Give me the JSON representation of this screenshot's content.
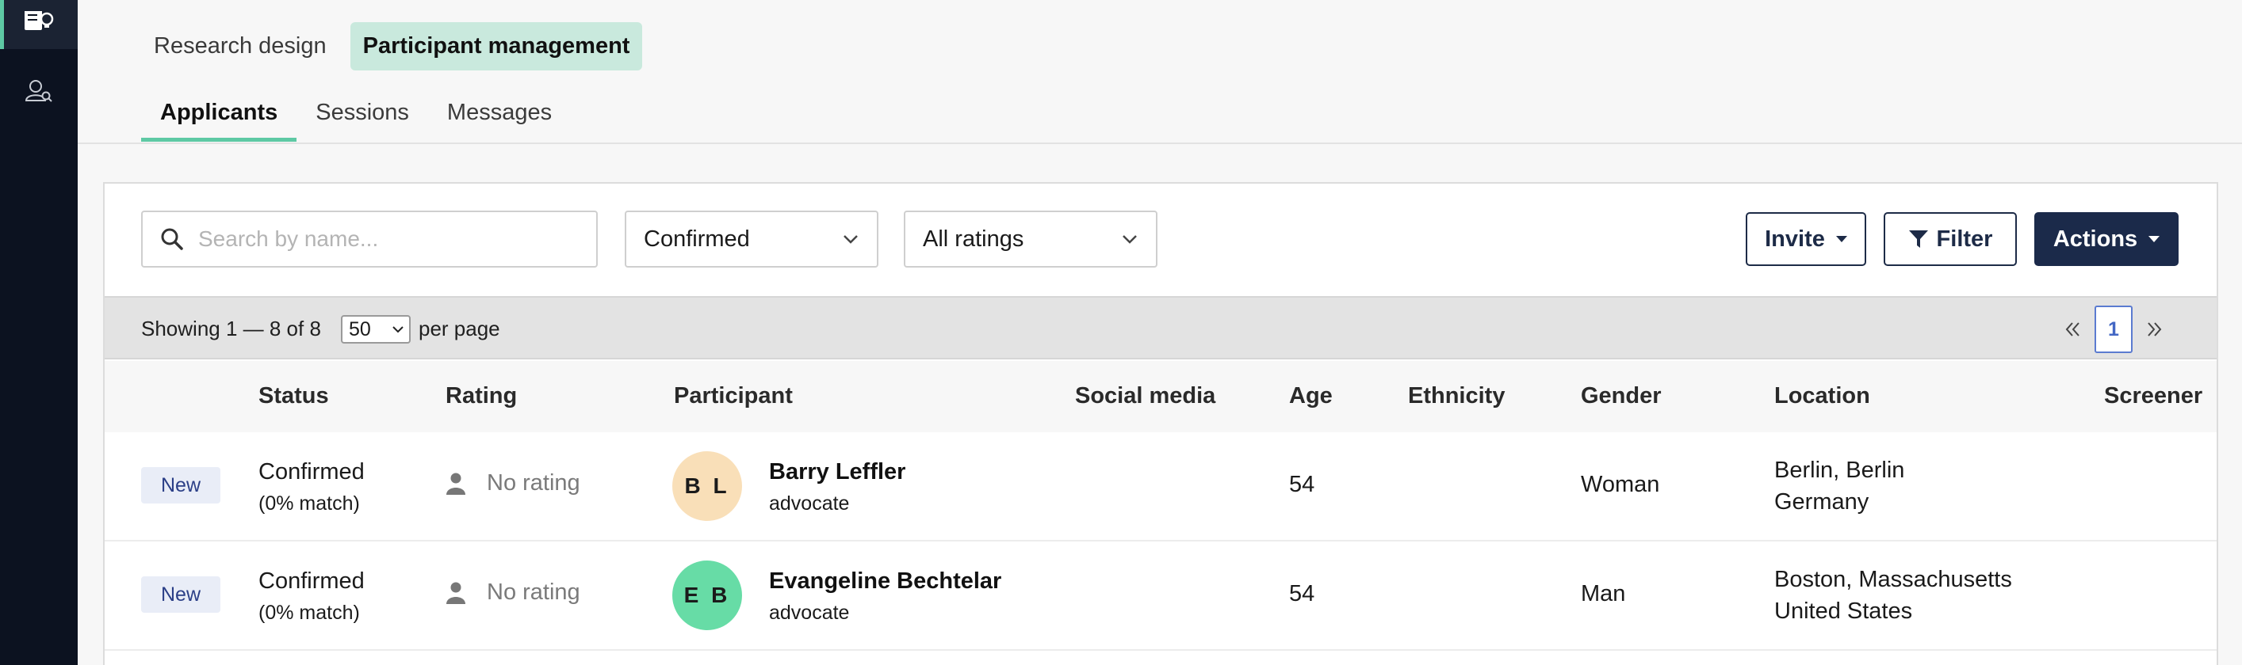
{
  "sidebar": {
    "items": [
      {
        "icon": "document-lightbulb-icon"
      },
      {
        "icon": "user-search-icon"
      }
    ]
  },
  "top_tabs": [
    {
      "label": "Research design"
    },
    {
      "label": "Participant management",
      "active": true
    }
  ],
  "sub_tabs": [
    {
      "label": "Applicants",
      "active": true
    },
    {
      "label": "Sessions"
    },
    {
      "label": "Messages"
    }
  ],
  "toolbar": {
    "search_placeholder": "Search by name...",
    "status_filter": "Confirmed",
    "rating_filter": "All ratings",
    "invite_label": "Invite",
    "filter_label": "Filter",
    "actions_label": "Actions"
  },
  "pager": {
    "showing": "Showing 1 — 8 of 8",
    "per_page_value": "50",
    "per_page_label": "per page",
    "current_page": "1"
  },
  "table": {
    "headers": {
      "status": "Status",
      "rating": "Rating",
      "participant": "Participant",
      "social": "Social media",
      "age": "Age",
      "ethnicity": "Ethnicity",
      "gender": "Gender",
      "location": "Location",
      "screener": "Screener"
    },
    "rows": [
      {
        "badge": "New",
        "status": "Confirmed",
        "match": "(0% match)",
        "rating": "No rating",
        "initials": "B L",
        "avatar_color": "#f9dfb8",
        "name": "Barry Leffler",
        "role": "advocate",
        "age": "54",
        "gender": "Woman",
        "location_line1": "Berlin, Berlin",
        "location_line2": "Germany"
      },
      {
        "badge": "New",
        "status": "Confirmed",
        "match": "(0% match)",
        "rating": "No rating",
        "initials": "E B",
        "avatar_color": "#67dca6",
        "name": "Evangeline Bechtelar",
        "role": "advocate",
        "age": "54",
        "gender": "Man",
        "location_line1": "Boston, Massachusetts",
        "location_line2": "United States"
      }
    ]
  }
}
